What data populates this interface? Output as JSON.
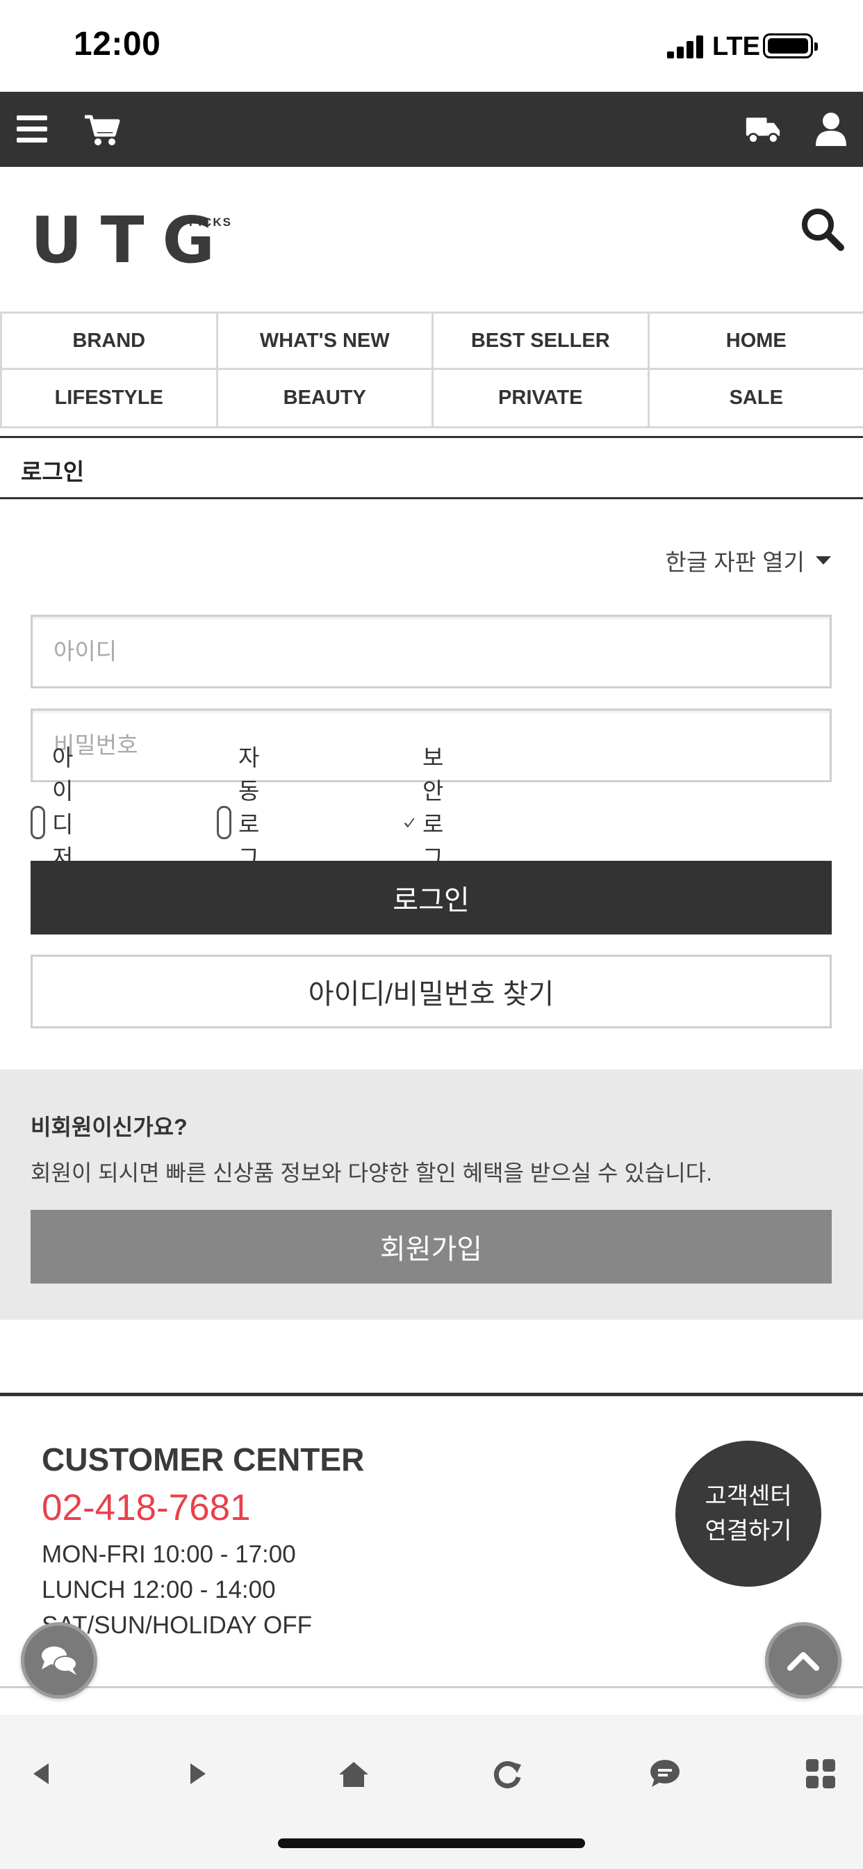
{
  "status_bar": {
    "time": "12:00",
    "network": "LTE"
  },
  "logo": {
    "text": "UTG",
    "sub": "PICKS"
  },
  "categories": [
    "BRAND",
    "WHAT'S NEW",
    "BEST SELLER",
    "HOME",
    "LIFESTYLE",
    "BEAUTY",
    "PRIVATE",
    "SALE"
  ],
  "page_title": "로그인",
  "keyboard_toggle": "한글 자판 열기",
  "login_form": {
    "id_placeholder": "아이디",
    "pw_placeholder": "비밀번호",
    "save_id": "아이디 저장",
    "auto_login": "자동 로그인",
    "secure_login": "보안 로그인",
    "login_button": "로그인",
    "find_button": "아이디/비밀번호 찾기"
  },
  "nonmember": {
    "question": "비회원이신가요?",
    "description": "회원이 되시면 빠른 신상품 정보와 다양한 할인 혜택을 받으실 수 있습니다.",
    "join_button": "회원가입"
  },
  "customer_center": {
    "title": "CUSTOMER CENTER",
    "phone": "02-418-7681",
    "hours": [
      "MON-FRI 10:00 - 17:00",
      "LUNCH 12:00 - 14:00",
      "SAT/SUN/HOLIDAY OFF"
    ],
    "connect_line1": "고객센터",
    "connect_line2": "연결하기"
  },
  "colors": {
    "dark": "#333333",
    "accent_phone": "#e8414a",
    "join_button": "#878787",
    "panel": "#e9e9e9"
  },
  "icons": [
    "menu-icon",
    "cart-icon",
    "truck-icon",
    "user-icon",
    "search-icon",
    "chat-icon",
    "scroll-top-icon",
    "back-icon",
    "forward-icon",
    "home-icon",
    "reload-icon",
    "message-icon",
    "apps-icon"
  ]
}
